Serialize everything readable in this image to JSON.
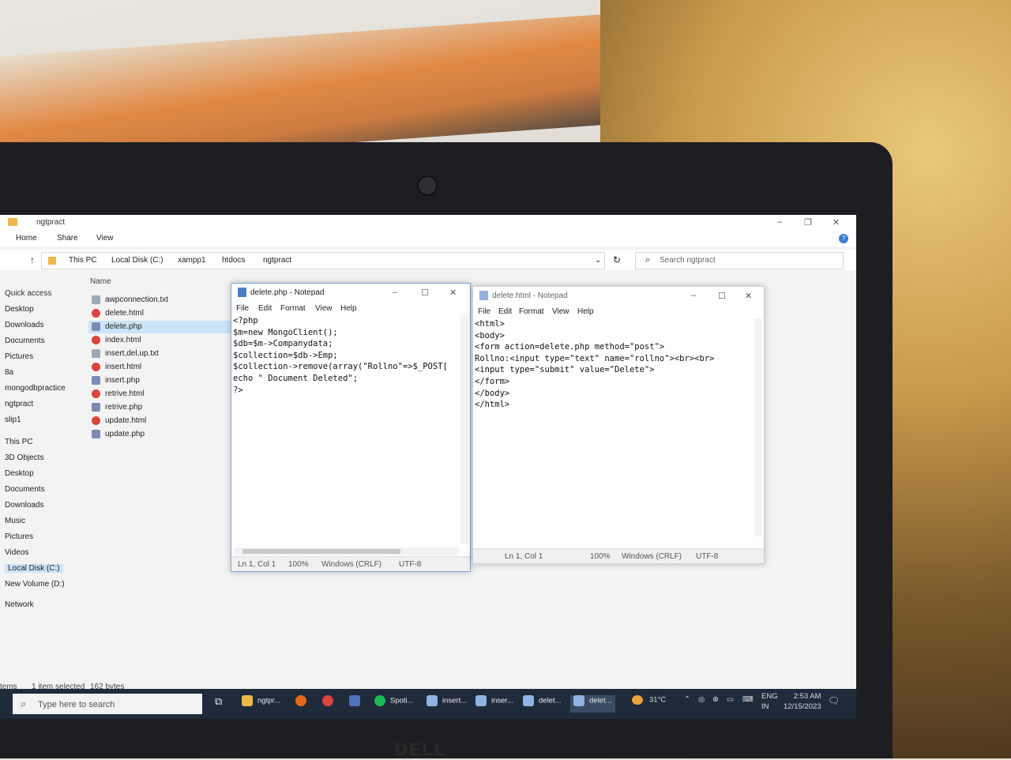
{
  "explorer": {
    "title": "ngtpract",
    "ribbon_tabs": [
      "Home",
      "Share",
      "View"
    ],
    "breadcrumb": [
      "This PC",
      "Local Disk (C:)",
      "xampp1",
      "htdocs",
      "ngtpract"
    ],
    "search_placeholder": "Search ngtpract",
    "column_name": "Name",
    "nav_items": [
      "Quick access",
      "Desktop",
      "Downloads",
      "Documents",
      "Pictures",
      "8a",
      "mongodbpractice",
      "ngtpract",
      "slip1",
      "This PC",
      "3D Objects",
      "Desktop",
      "Documents",
      "Downloads",
      "Music",
      "Pictures",
      "Videos",
      "Local Disk (C:)",
      "New Volume (D:)",
      "Network"
    ],
    "files": [
      {
        "name": "awpconnection.txt",
        "icon": "text-file-icon"
      },
      {
        "name": "delete.html",
        "icon": "chrome-file-icon"
      },
      {
        "name": "delete.php",
        "icon": "php-file-icon"
      },
      {
        "name": "index.html",
        "icon": "chrome-file-icon"
      },
      {
        "name": "insert,del,up.txt",
        "icon": "text-file-icon"
      },
      {
        "name": "insert.html",
        "icon": "chrome-file-icon"
      },
      {
        "name": "insert.php",
        "icon": "php-file-icon"
      },
      {
        "name": "retrive.html",
        "icon": "chrome-file-icon"
      },
      {
        "name": "retrive.php",
        "icon": "php-file-icon"
      },
      {
        "name": "update.html",
        "icon": "chrome-file-icon"
      },
      {
        "name": "update.php",
        "icon": "php-file-icon"
      }
    ],
    "status_items": "tems",
    "status_selected": "1 item selected",
    "status_size": "162 bytes"
  },
  "notepad1": {
    "title": "delete.php - Notepad",
    "menu": [
      "File",
      "Edit",
      "Format",
      "View",
      "Help"
    ],
    "content": "<?php\n$m=new MongoClient();\n$db=$m->Companydata;\n$collection=$db->Emp;\n$collection->remove(array(\"Rollno\"=>$_POST[\necho \" Document Deleted\";\n?>",
    "status": {
      "pos": "Ln 1, Col 1",
      "zoom": "100%",
      "eol": "Windows (CRLF)",
      "enc": "UTF-8"
    }
  },
  "notepad2": {
    "title": "delete.html - Notepad",
    "menu": [
      "File",
      "Edit",
      "Format",
      "View",
      "Help"
    ],
    "content": "<html>\n<body>\n<form action=delete.php method=\"post\">\nRollno:<input type=\"text\" name=\"rollno\"><br><br>\n<input type=\"submit\" value=\"Delete\">\n</form>\n</body>\n</html>",
    "status": {
      "pos": "Ln 1, Col 1",
      "zoom": "100%",
      "eol": "Windows (CRLF)",
      "enc": "UTF-8"
    }
  },
  "taskbar": {
    "search_placeholder": "Type here to search",
    "apps": [
      {
        "label": "ngtpr...",
        "icon": "folder-icon"
      },
      {
        "label": "",
        "icon": "firefox-icon"
      },
      {
        "label": "",
        "icon": "chrome-icon"
      },
      {
        "label": "",
        "icon": "calculator-icon"
      },
      {
        "label": "Spoti...",
        "icon": "spotify-icon"
      },
      {
        "label": "insert...",
        "icon": "notepad-icon"
      },
      {
        "label": "inser...",
        "icon": "notepad-icon"
      },
      {
        "label": "delet...",
        "icon": "notepad-icon"
      },
      {
        "label": "delet...",
        "icon": "notepad-icon"
      }
    ],
    "weather": "31°C",
    "lang_top": "ENG",
    "lang_bottom": "IN",
    "time": "2:53 AM",
    "date": "12/15/2023"
  },
  "colors": {
    "taskbar": "#1f2a3a",
    "selection": "#cce4f7",
    "folder": "#e9b94a"
  }
}
